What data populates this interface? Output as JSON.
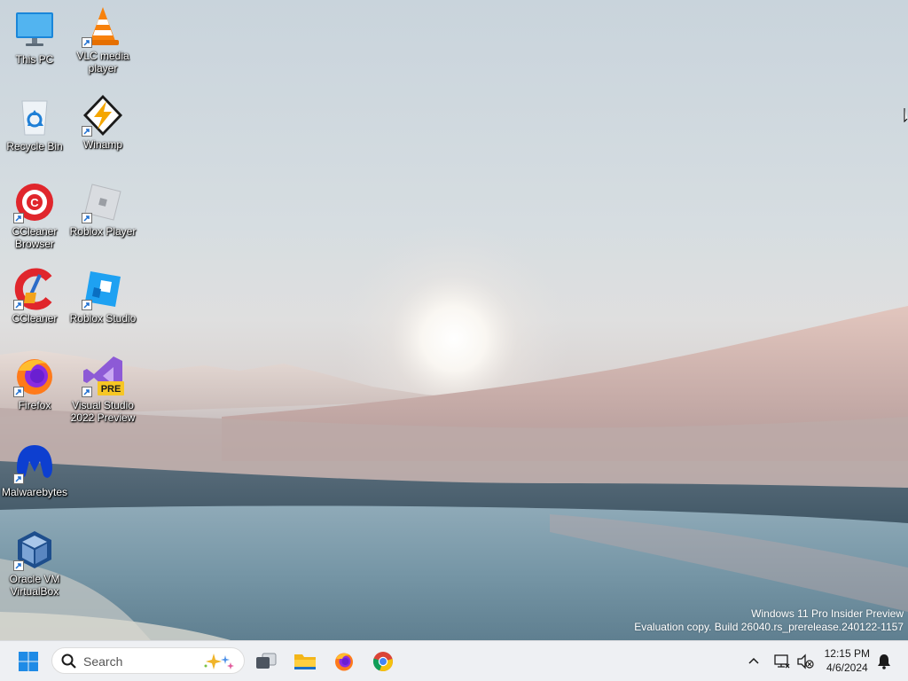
{
  "desktop": {
    "icons": [
      {
        "id": "this-pc",
        "label": "This PC",
        "shortcut": false
      },
      {
        "id": "vlc",
        "label": "VLC media player",
        "shortcut": true
      },
      {
        "id": "recycle-bin",
        "label": "Recycle Bin",
        "shortcut": false
      },
      {
        "id": "winamp",
        "label": "Winamp",
        "shortcut": true
      },
      {
        "id": "ccleaner-browser",
        "label": "CCleaner Browser",
        "shortcut": true
      },
      {
        "id": "roblox-player",
        "label": "Roblox Player",
        "shortcut": true
      },
      {
        "id": "ccleaner",
        "label": "CCleaner",
        "shortcut": true
      },
      {
        "id": "roblox-studio",
        "label": "Roblox Studio",
        "shortcut": true
      },
      {
        "id": "firefox",
        "label": "Firefox",
        "shortcut": true
      },
      {
        "id": "visual-studio",
        "label": "Visual Studio 2022 Preview",
        "shortcut": true
      },
      {
        "id": "malwarebytes",
        "label": "Malwarebytes",
        "shortcut": true
      },
      {
        "id": "virtualbox",
        "label": "Oracle VM VirtualBox",
        "shortcut": true
      }
    ],
    "vs_badge": "PRE"
  },
  "watermark": {
    "line1": "Windows 11 Pro Insider Preview",
    "line2": "Evaluation copy. Build 26040.rs_prerelease.240122-1157"
  },
  "taskbar": {
    "search_placeholder": "Search",
    "apps": [
      "task-view",
      "file-explorer",
      "firefox",
      "chrome"
    ],
    "clock": {
      "time": "12:15 PM",
      "date": "4/6/2024"
    }
  },
  "colors": {
    "taskbar_bg": "#eef0f3",
    "windows_blue": "#0078d4"
  }
}
